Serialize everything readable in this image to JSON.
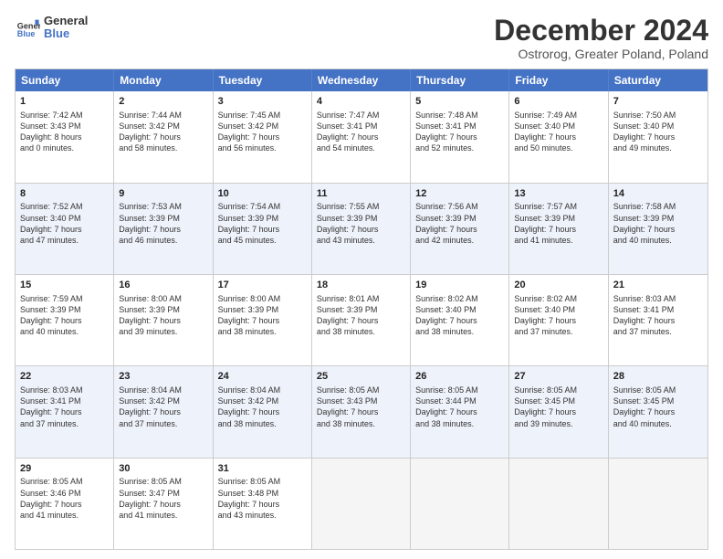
{
  "logo": {
    "line1": "General",
    "line2": "Blue"
  },
  "title": "December 2024",
  "subtitle": "Ostrorog, Greater Poland, Poland",
  "weekdays": [
    "Sunday",
    "Monday",
    "Tuesday",
    "Wednesday",
    "Thursday",
    "Friday",
    "Saturday"
  ],
  "weeks": [
    [
      {
        "day": "1",
        "lines": [
          "Sunrise: 7:42 AM",
          "Sunset: 3:43 PM",
          "Daylight: 8 hours",
          "and 0 minutes."
        ]
      },
      {
        "day": "2",
        "lines": [
          "Sunrise: 7:44 AM",
          "Sunset: 3:42 PM",
          "Daylight: 7 hours",
          "and 58 minutes."
        ]
      },
      {
        "day": "3",
        "lines": [
          "Sunrise: 7:45 AM",
          "Sunset: 3:42 PM",
          "Daylight: 7 hours",
          "and 56 minutes."
        ]
      },
      {
        "day": "4",
        "lines": [
          "Sunrise: 7:47 AM",
          "Sunset: 3:41 PM",
          "Daylight: 7 hours",
          "and 54 minutes."
        ]
      },
      {
        "day": "5",
        "lines": [
          "Sunrise: 7:48 AM",
          "Sunset: 3:41 PM",
          "Daylight: 7 hours",
          "and 52 minutes."
        ]
      },
      {
        "day": "6",
        "lines": [
          "Sunrise: 7:49 AM",
          "Sunset: 3:40 PM",
          "Daylight: 7 hours",
          "and 50 minutes."
        ]
      },
      {
        "day": "7",
        "lines": [
          "Sunrise: 7:50 AM",
          "Sunset: 3:40 PM",
          "Daylight: 7 hours",
          "and 49 minutes."
        ]
      }
    ],
    [
      {
        "day": "8",
        "lines": [
          "Sunrise: 7:52 AM",
          "Sunset: 3:40 PM",
          "Daylight: 7 hours",
          "and 47 minutes."
        ]
      },
      {
        "day": "9",
        "lines": [
          "Sunrise: 7:53 AM",
          "Sunset: 3:39 PM",
          "Daylight: 7 hours",
          "and 46 minutes."
        ]
      },
      {
        "day": "10",
        "lines": [
          "Sunrise: 7:54 AM",
          "Sunset: 3:39 PM",
          "Daylight: 7 hours",
          "and 45 minutes."
        ]
      },
      {
        "day": "11",
        "lines": [
          "Sunrise: 7:55 AM",
          "Sunset: 3:39 PM",
          "Daylight: 7 hours",
          "and 43 minutes."
        ]
      },
      {
        "day": "12",
        "lines": [
          "Sunrise: 7:56 AM",
          "Sunset: 3:39 PM",
          "Daylight: 7 hours",
          "and 42 minutes."
        ]
      },
      {
        "day": "13",
        "lines": [
          "Sunrise: 7:57 AM",
          "Sunset: 3:39 PM",
          "Daylight: 7 hours",
          "and 41 minutes."
        ]
      },
      {
        "day": "14",
        "lines": [
          "Sunrise: 7:58 AM",
          "Sunset: 3:39 PM",
          "Daylight: 7 hours",
          "and 40 minutes."
        ]
      }
    ],
    [
      {
        "day": "15",
        "lines": [
          "Sunrise: 7:59 AM",
          "Sunset: 3:39 PM",
          "Daylight: 7 hours",
          "and 40 minutes."
        ]
      },
      {
        "day": "16",
        "lines": [
          "Sunrise: 8:00 AM",
          "Sunset: 3:39 PM",
          "Daylight: 7 hours",
          "and 39 minutes."
        ]
      },
      {
        "day": "17",
        "lines": [
          "Sunrise: 8:00 AM",
          "Sunset: 3:39 PM",
          "Daylight: 7 hours",
          "and 38 minutes."
        ]
      },
      {
        "day": "18",
        "lines": [
          "Sunrise: 8:01 AM",
          "Sunset: 3:39 PM",
          "Daylight: 7 hours",
          "and 38 minutes."
        ]
      },
      {
        "day": "19",
        "lines": [
          "Sunrise: 8:02 AM",
          "Sunset: 3:40 PM",
          "Daylight: 7 hours",
          "and 38 minutes."
        ]
      },
      {
        "day": "20",
        "lines": [
          "Sunrise: 8:02 AM",
          "Sunset: 3:40 PM",
          "Daylight: 7 hours",
          "and 37 minutes."
        ]
      },
      {
        "day": "21",
        "lines": [
          "Sunrise: 8:03 AM",
          "Sunset: 3:41 PM",
          "Daylight: 7 hours",
          "and 37 minutes."
        ]
      }
    ],
    [
      {
        "day": "22",
        "lines": [
          "Sunrise: 8:03 AM",
          "Sunset: 3:41 PM",
          "Daylight: 7 hours",
          "and 37 minutes."
        ]
      },
      {
        "day": "23",
        "lines": [
          "Sunrise: 8:04 AM",
          "Sunset: 3:42 PM",
          "Daylight: 7 hours",
          "and 37 minutes."
        ]
      },
      {
        "day": "24",
        "lines": [
          "Sunrise: 8:04 AM",
          "Sunset: 3:42 PM",
          "Daylight: 7 hours",
          "and 38 minutes."
        ]
      },
      {
        "day": "25",
        "lines": [
          "Sunrise: 8:05 AM",
          "Sunset: 3:43 PM",
          "Daylight: 7 hours",
          "and 38 minutes."
        ]
      },
      {
        "day": "26",
        "lines": [
          "Sunrise: 8:05 AM",
          "Sunset: 3:44 PM",
          "Daylight: 7 hours",
          "and 38 minutes."
        ]
      },
      {
        "day": "27",
        "lines": [
          "Sunrise: 8:05 AM",
          "Sunset: 3:45 PM",
          "Daylight: 7 hours",
          "and 39 minutes."
        ]
      },
      {
        "day": "28",
        "lines": [
          "Sunrise: 8:05 AM",
          "Sunset: 3:45 PM",
          "Daylight: 7 hours",
          "and 40 minutes."
        ]
      }
    ],
    [
      {
        "day": "29",
        "lines": [
          "Sunrise: 8:05 AM",
          "Sunset: 3:46 PM",
          "Daylight: 7 hours",
          "and 41 minutes."
        ]
      },
      {
        "day": "30",
        "lines": [
          "Sunrise: 8:05 AM",
          "Sunset: 3:47 PM",
          "Daylight: 7 hours",
          "and 41 minutes."
        ]
      },
      {
        "day": "31",
        "lines": [
          "Sunrise: 8:05 AM",
          "Sunset: 3:48 PM",
          "Daylight: 7 hours",
          "and 43 minutes."
        ]
      },
      {
        "day": "",
        "lines": []
      },
      {
        "day": "",
        "lines": []
      },
      {
        "day": "",
        "lines": []
      },
      {
        "day": "",
        "lines": []
      }
    ]
  ]
}
